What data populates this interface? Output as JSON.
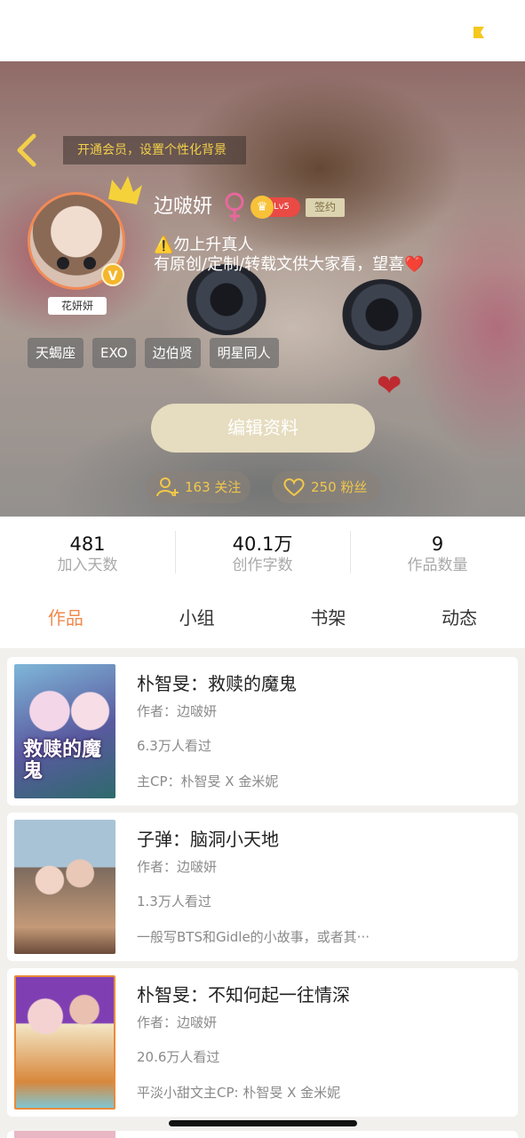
{
  "header": {
    "vip_banner": "开通会员，设置个性化背景"
  },
  "profile": {
    "username": "边啵妍",
    "level": "Lv5",
    "signed": "签约",
    "avatar_tag": "花妍妍",
    "vip_mark": "V",
    "bio_line1": "⚠️勿上升真人",
    "bio_line2": "有原创/定制/转载文供大家看，望喜❤️",
    "tags": [
      "天蝎座",
      "EXO",
      "边伯贤",
      "明星同人"
    ],
    "edit_button": "编辑资料",
    "follow": "163 关注",
    "fans": "250 粉丝"
  },
  "stats": [
    {
      "value": "481",
      "label": "加入天数"
    },
    {
      "value": "40.1万",
      "label": "创作字数"
    },
    {
      "value": "9",
      "label": "作品数量"
    }
  ],
  "tabs": [
    {
      "label": "作品",
      "active": true
    },
    {
      "label": "小组",
      "active": false
    },
    {
      "label": "书架",
      "active": false
    },
    {
      "label": "动态",
      "active": false
    }
  ],
  "works": [
    {
      "title": "朴智旻：救赎的魔鬼",
      "author": "作者：边啵妍",
      "views": "6.3万人看过",
      "desc": "主CP：朴智旻 X 金米妮",
      "cover_text": "救赎的魔鬼"
    },
    {
      "title": "子弹：脑洞小天地",
      "author": "作者：边啵妍",
      "views": "1.3万人看过",
      "desc": "一般写BTS和Gidle的小故事，或者其···",
      "cover_text": ""
    },
    {
      "title": "朴智旻：不知何起一往情深",
      "author": "作者：边啵妍",
      "views": "20.6万人看过",
      "desc": "平淡小甜文主CP: 朴智旻 X 金米妮",
      "cover_text": ""
    }
  ],
  "colors": {
    "accent": "#f08a4e",
    "gold": "#f0c84a",
    "level_red": "#ea4a44"
  }
}
